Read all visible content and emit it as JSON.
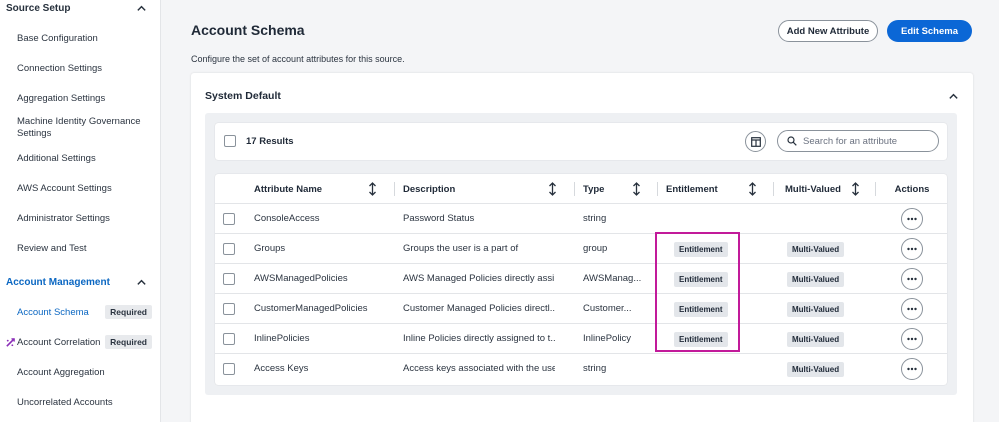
{
  "sidebar": {
    "source_setup": {
      "label": "Source Setup"
    },
    "setup_items": [
      {
        "label": "Base Configuration"
      },
      {
        "label": "Connection Settings"
      },
      {
        "label": "Aggregation Settings"
      },
      {
        "label": "Machine Identity Governance Settings"
      },
      {
        "label": "Additional Settings"
      },
      {
        "label": "AWS Account Settings"
      },
      {
        "label": "Administrator Settings"
      },
      {
        "label": "Review and Test"
      }
    ],
    "account_management": {
      "label": "Account Management"
    },
    "account_items": [
      {
        "label": "Account Schema",
        "badge": "Required"
      },
      {
        "label": "Account Correlation",
        "badge": "Required",
        "icon": "warning-icon"
      },
      {
        "label": "Account Aggregation"
      },
      {
        "label": "Uncorrelated Accounts"
      }
    ]
  },
  "header": {
    "title": "Account Schema",
    "subtitle": "Configure the set of account attributes for this source.",
    "add_button": "Add New Attribute",
    "edit_button": "Edit Schema"
  },
  "section": {
    "title": "System Default"
  },
  "toolbar": {
    "results": "17 Results",
    "search_placeholder": "Search for an attribute"
  },
  "table": {
    "columns": [
      "Attribute Name",
      "Description",
      "Type",
      "Entitlement",
      "Multi-Valued",
      "Actions"
    ],
    "rows": [
      {
        "name": "ConsoleAccess",
        "description": "Password Status",
        "type": "string",
        "entitlement": "",
        "multi_valued": ""
      },
      {
        "name": "Groups",
        "description": "Groups the user is a part of",
        "type": "group",
        "entitlement": "Entitlement",
        "multi_valued": "Multi-Valued"
      },
      {
        "name": "AWSManagedPolicies",
        "description": "AWS Managed Policies directly assi...",
        "type": "AWSManag...",
        "entitlement": "Entitlement",
        "multi_valued": "Multi-Valued"
      },
      {
        "name": "CustomerManagedPolicies",
        "description": "Customer Managed Policies directl...",
        "type": "Customer...",
        "entitlement": "Entitlement",
        "multi_valued": "Multi-Valued"
      },
      {
        "name": "InlinePolicies",
        "description": "Inline Policies directly assigned to t...",
        "type": "InlinePolicy",
        "entitlement": "Entitlement",
        "multi_valued": "Multi-Valued"
      },
      {
        "name": "Access Keys",
        "description": "Access keys associated with the user",
        "type": "string",
        "entitlement": "",
        "multi_valued": "Multi-Valued"
      }
    ]
  },
  "colors": {
    "accent": "#0b67d6",
    "highlight": "#c21a9a"
  }
}
